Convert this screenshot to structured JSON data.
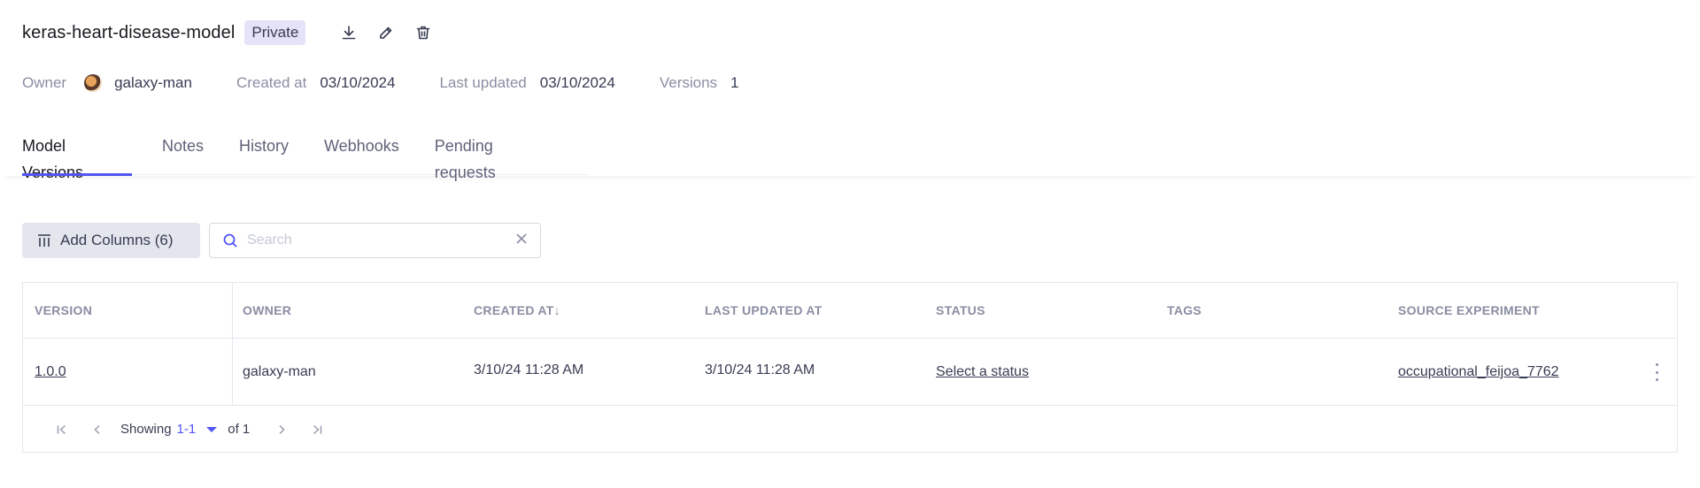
{
  "model": {
    "name": "keras-heart-disease-model",
    "visibility": "Private",
    "icons": [
      "download-icon",
      "edit-icon",
      "delete-icon"
    ]
  },
  "meta": {
    "owner_label": "Owner",
    "owner_name": "galaxy-man",
    "created_label": "Created at",
    "created_value": "03/10/2024",
    "updated_label": "Last updated",
    "updated_value": "03/10/2024",
    "versions_label": "Versions",
    "versions_value": "1"
  },
  "tabs": [
    {
      "label": "Model Versions",
      "active": true
    },
    {
      "label": "Notes",
      "active": false
    },
    {
      "label": "History",
      "active": false
    },
    {
      "label": "Webhooks",
      "active": false
    },
    {
      "label": "Pending requests",
      "active": false
    }
  ],
  "toolbar": {
    "add_columns_label": "Add Columns (6)",
    "search_placeholder": "Search",
    "search_value": ""
  },
  "table": {
    "columns": [
      "VERSION",
      "OWNER",
      "CREATED AT",
      "LAST UPDATED AT",
      "STATUS",
      "TAGS",
      "SOURCE EXPERIMENT"
    ],
    "sort_indicator": "↓",
    "rows": [
      {
        "version": "1.0.0",
        "owner": "galaxy-man",
        "created_at": "3/10/24 11:28 AM",
        "last_updated_at": "3/10/24 11:28 AM",
        "status": "Select a status",
        "tags": "",
        "source_experiment": "occupational_feijoa_7762"
      }
    ]
  },
  "pagination": {
    "showing_label": "Showing",
    "range": "1-1",
    "of_label": "of 1"
  },
  "colors": {
    "accent": "#5155f5",
    "badge_bg": "#e4e3f8",
    "muted_text": "#8a8ea3"
  }
}
